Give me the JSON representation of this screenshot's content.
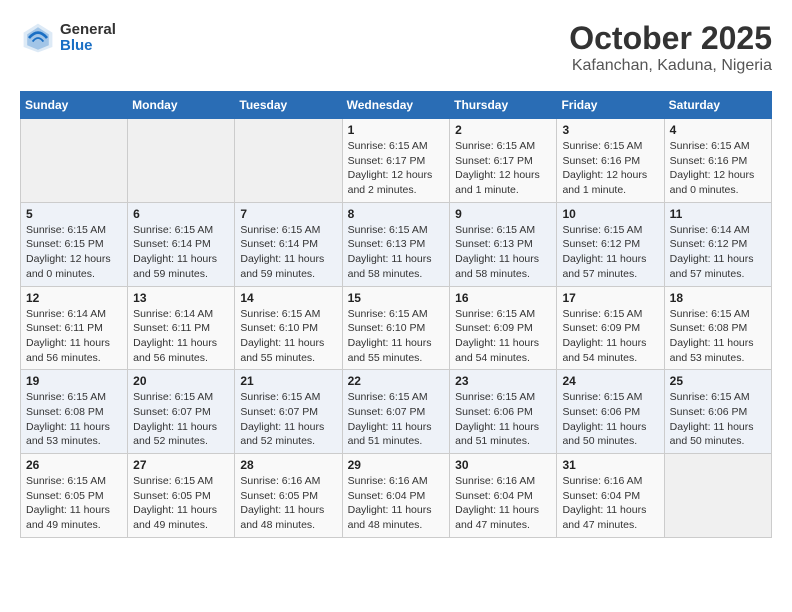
{
  "header": {
    "logo_general": "General",
    "logo_blue": "Blue",
    "title": "October 2025",
    "subtitle": "Kafanchan, Kaduna, Nigeria"
  },
  "weekdays": [
    "Sunday",
    "Monday",
    "Tuesday",
    "Wednesday",
    "Thursday",
    "Friday",
    "Saturday"
  ],
  "weeks": [
    [
      {
        "day": "",
        "info": ""
      },
      {
        "day": "",
        "info": ""
      },
      {
        "day": "",
        "info": ""
      },
      {
        "day": "1",
        "info": "Sunrise: 6:15 AM\nSunset: 6:17 PM\nDaylight: 12 hours\nand 2 minutes."
      },
      {
        "day": "2",
        "info": "Sunrise: 6:15 AM\nSunset: 6:17 PM\nDaylight: 12 hours\nand 1 minute."
      },
      {
        "day": "3",
        "info": "Sunrise: 6:15 AM\nSunset: 6:16 PM\nDaylight: 12 hours\nand 1 minute."
      },
      {
        "day": "4",
        "info": "Sunrise: 6:15 AM\nSunset: 6:16 PM\nDaylight: 12 hours\nand 0 minutes."
      }
    ],
    [
      {
        "day": "5",
        "info": "Sunrise: 6:15 AM\nSunset: 6:15 PM\nDaylight: 12 hours\nand 0 minutes."
      },
      {
        "day": "6",
        "info": "Sunrise: 6:15 AM\nSunset: 6:14 PM\nDaylight: 11 hours\nand 59 minutes."
      },
      {
        "day": "7",
        "info": "Sunrise: 6:15 AM\nSunset: 6:14 PM\nDaylight: 11 hours\nand 59 minutes."
      },
      {
        "day": "8",
        "info": "Sunrise: 6:15 AM\nSunset: 6:13 PM\nDaylight: 11 hours\nand 58 minutes."
      },
      {
        "day": "9",
        "info": "Sunrise: 6:15 AM\nSunset: 6:13 PM\nDaylight: 11 hours\nand 58 minutes."
      },
      {
        "day": "10",
        "info": "Sunrise: 6:15 AM\nSunset: 6:12 PM\nDaylight: 11 hours\nand 57 minutes."
      },
      {
        "day": "11",
        "info": "Sunrise: 6:14 AM\nSunset: 6:12 PM\nDaylight: 11 hours\nand 57 minutes."
      }
    ],
    [
      {
        "day": "12",
        "info": "Sunrise: 6:14 AM\nSunset: 6:11 PM\nDaylight: 11 hours\nand 56 minutes."
      },
      {
        "day": "13",
        "info": "Sunrise: 6:14 AM\nSunset: 6:11 PM\nDaylight: 11 hours\nand 56 minutes."
      },
      {
        "day": "14",
        "info": "Sunrise: 6:15 AM\nSunset: 6:10 PM\nDaylight: 11 hours\nand 55 minutes."
      },
      {
        "day": "15",
        "info": "Sunrise: 6:15 AM\nSunset: 6:10 PM\nDaylight: 11 hours\nand 55 minutes."
      },
      {
        "day": "16",
        "info": "Sunrise: 6:15 AM\nSunset: 6:09 PM\nDaylight: 11 hours\nand 54 minutes."
      },
      {
        "day": "17",
        "info": "Sunrise: 6:15 AM\nSunset: 6:09 PM\nDaylight: 11 hours\nand 54 minutes."
      },
      {
        "day": "18",
        "info": "Sunrise: 6:15 AM\nSunset: 6:08 PM\nDaylight: 11 hours\nand 53 minutes."
      }
    ],
    [
      {
        "day": "19",
        "info": "Sunrise: 6:15 AM\nSunset: 6:08 PM\nDaylight: 11 hours\nand 53 minutes."
      },
      {
        "day": "20",
        "info": "Sunrise: 6:15 AM\nSunset: 6:07 PM\nDaylight: 11 hours\nand 52 minutes."
      },
      {
        "day": "21",
        "info": "Sunrise: 6:15 AM\nSunset: 6:07 PM\nDaylight: 11 hours\nand 52 minutes."
      },
      {
        "day": "22",
        "info": "Sunrise: 6:15 AM\nSunset: 6:07 PM\nDaylight: 11 hours\nand 51 minutes."
      },
      {
        "day": "23",
        "info": "Sunrise: 6:15 AM\nSunset: 6:06 PM\nDaylight: 11 hours\nand 51 minutes."
      },
      {
        "day": "24",
        "info": "Sunrise: 6:15 AM\nSunset: 6:06 PM\nDaylight: 11 hours\nand 50 minutes."
      },
      {
        "day": "25",
        "info": "Sunrise: 6:15 AM\nSunset: 6:06 PM\nDaylight: 11 hours\nand 50 minutes."
      }
    ],
    [
      {
        "day": "26",
        "info": "Sunrise: 6:15 AM\nSunset: 6:05 PM\nDaylight: 11 hours\nand 49 minutes."
      },
      {
        "day": "27",
        "info": "Sunrise: 6:15 AM\nSunset: 6:05 PM\nDaylight: 11 hours\nand 49 minutes."
      },
      {
        "day": "28",
        "info": "Sunrise: 6:16 AM\nSunset: 6:05 PM\nDaylight: 11 hours\nand 48 minutes."
      },
      {
        "day": "29",
        "info": "Sunrise: 6:16 AM\nSunset: 6:04 PM\nDaylight: 11 hours\nand 48 minutes."
      },
      {
        "day": "30",
        "info": "Sunrise: 6:16 AM\nSunset: 6:04 PM\nDaylight: 11 hours\nand 47 minutes."
      },
      {
        "day": "31",
        "info": "Sunrise: 6:16 AM\nSunset: 6:04 PM\nDaylight: 11 hours\nand 47 minutes."
      },
      {
        "day": "",
        "info": ""
      }
    ]
  ]
}
